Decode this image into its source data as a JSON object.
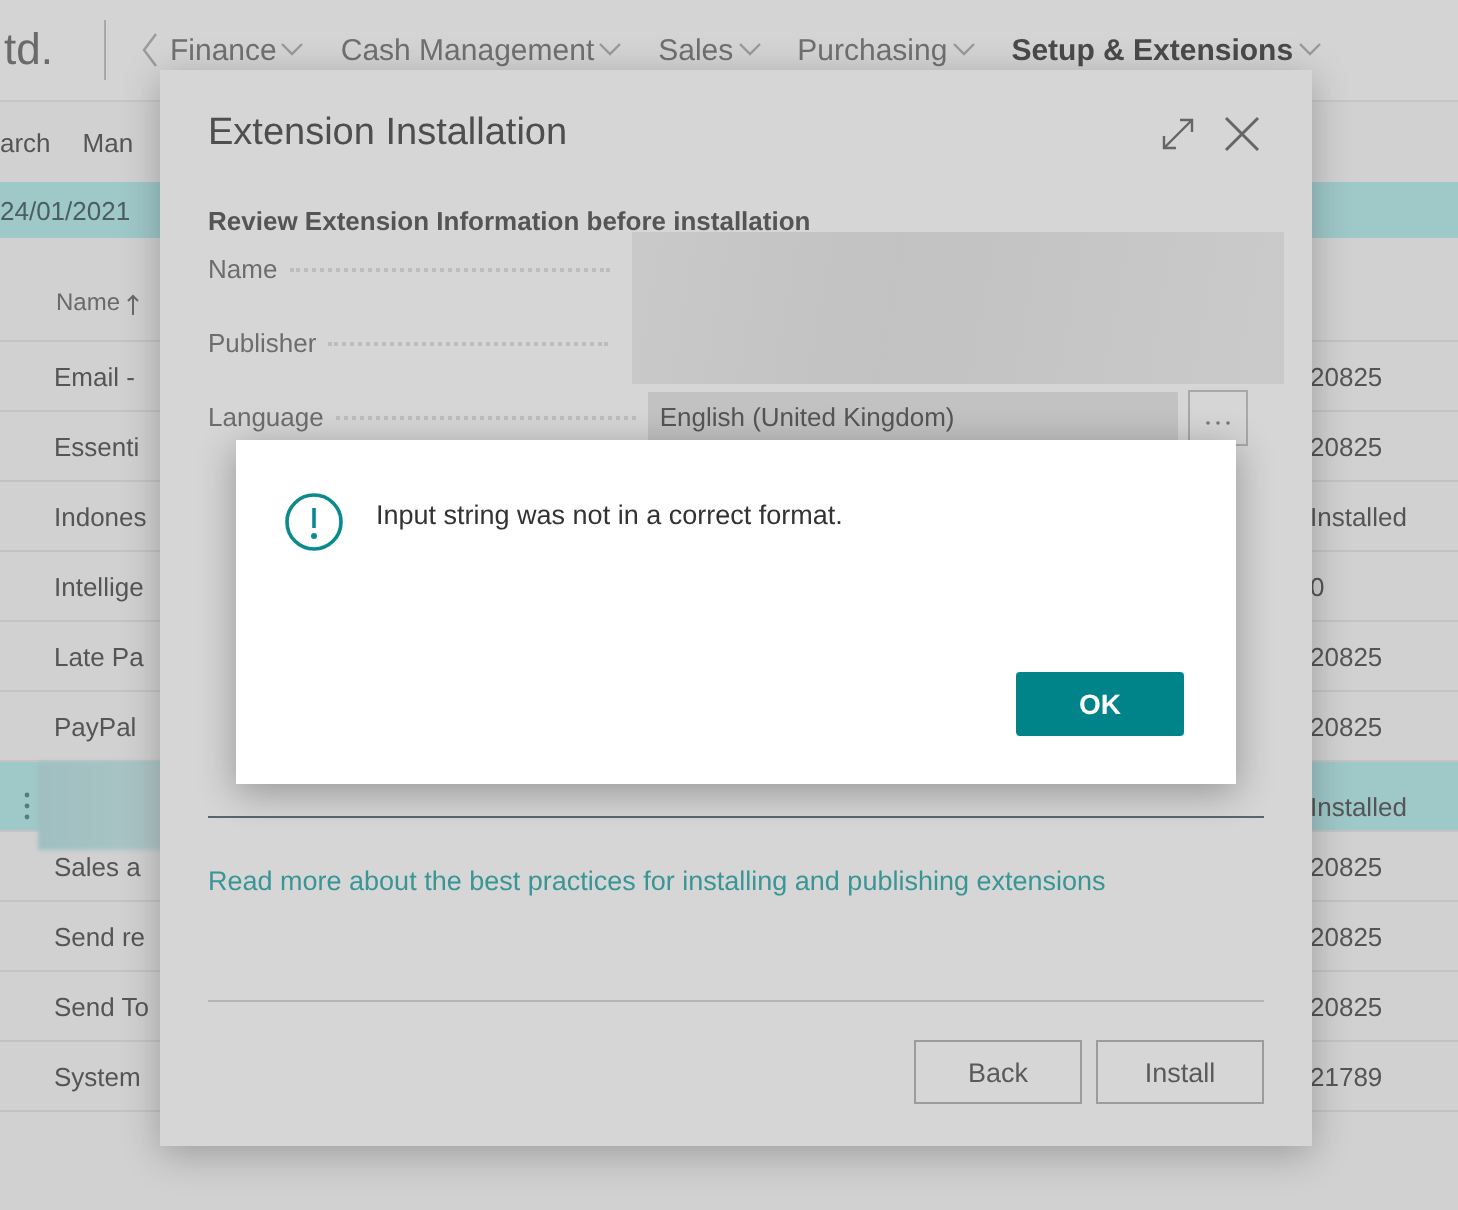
{
  "app": {
    "company": "td.",
    "nav": [
      {
        "label": "Finance",
        "selected": false
      },
      {
        "label": "Cash Management",
        "selected": false
      },
      {
        "label": "Sales",
        "selected": false
      },
      {
        "label": "Purchasing",
        "selected": false
      },
      {
        "label": "Setup & Extensions",
        "selected": true
      }
    ],
    "actions": [
      "arch",
      "Man"
    ],
    "banner": "24/01/2021"
  },
  "list": {
    "column": "Name",
    "rows": [
      {
        "name": "Email -",
        "value": "20825",
        "selected": false
      },
      {
        "name": "Essenti",
        "value": "20825",
        "selected": false
      },
      {
        "name": "Indones",
        "value": "Installed",
        "selected": false
      },
      {
        "name": "Intellige",
        "value": "0",
        "selected": false
      },
      {
        "name": "Late Pa",
        "value": "20825",
        "selected": false
      },
      {
        "name": "PayPal",
        "value": "20825",
        "selected": false
      },
      {
        "value": "Installed",
        "selected": true
      },
      {
        "name": "Sales a",
        "value": "20825",
        "selected": false
      },
      {
        "name": "Send re",
        "value": "20825",
        "selected": false
      },
      {
        "name": "Send To",
        "value": "20825",
        "selected": false
      },
      {
        "name": "System",
        "value": "21789",
        "selected": false
      }
    ]
  },
  "dialog": {
    "title": "Extension Installation",
    "subtitle": "Review Extension Information before installation",
    "fields": [
      {
        "label": "Name",
        "kind": "redacted"
      },
      {
        "label": "Publisher",
        "kind": "redacted"
      },
      {
        "label": "Language",
        "kind": "lookup",
        "value": "English (United Kingdom)"
      }
    ],
    "link": "Read more about the best practices for installing and publishing extensions",
    "buttons": [
      "Back",
      "Install"
    ]
  },
  "message": {
    "text": "Input string was not in a correct format.",
    "button": "OK"
  }
}
